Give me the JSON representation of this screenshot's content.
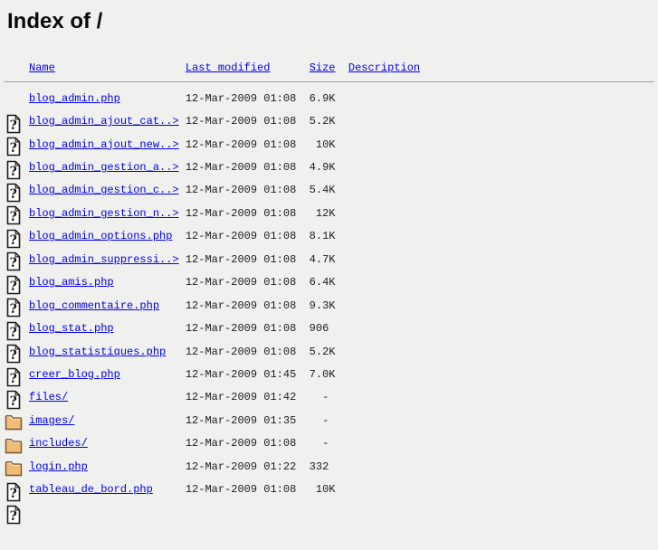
{
  "page_title": "Index of /",
  "listing": {
    "headers": [
      {
        "label": "Name"
      },
      {
        "label": "Last modified"
      },
      {
        "label": "Size"
      },
      {
        "label": "Description"
      }
    ],
    "rows": [
      {
        "icon": "unknown",
        "name": "blog_admin.php",
        "date": "12-Mar-2009 01:08",
        "size": "6.9K"
      },
      {
        "icon": "unknown",
        "name": "blog_admin_ajout_cat..>",
        "date": "12-Mar-2009 01:08",
        "size": "5.2K"
      },
      {
        "icon": "unknown",
        "name": "blog_admin_ajout_new..>",
        "date": "12-Mar-2009 01:08",
        "size": " 10K"
      },
      {
        "icon": "unknown",
        "name": "blog_admin_gestion_a..>",
        "date": "12-Mar-2009 01:08",
        "size": "4.9K"
      },
      {
        "icon": "unknown",
        "name": "blog_admin_gestion_c..>",
        "date": "12-Mar-2009 01:08",
        "size": "5.4K"
      },
      {
        "icon": "unknown",
        "name": "blog_admin_gestion_n..>",
        "date": "12-Mar-2009 01:08",
        "size": " 12K"
      },
      {
        "icon": "unknown",
        "name": "blog_admin_options.php",
        "date": "12-Mar-2009 01:08",
        "size": "8.1K"
      },
      {
        "icon": "unknown",
        "name": "blog_admin_suppressi..>",
        "date": "12-Mar-2009 01:08",
        "size": "4.7K"
      },
      {
        "icon": "unknown",
        "name": "blog_amis.php",
        "date": "12-Mar-2009 01:08",
        "size": "6.4K"
      },
      {
        "icon": "unknown",
        "name": "blog_commentaire.php",
        "date": "12-Mar-2009 01:08",
        "size": "9.3K"
      },
      {
        "icon": "unknown",
        "name": "blog_stat.php",
        "date": "12-Mar-2009 01:08",
        "size": "906 "
      },
      {
        "icon": "unknown",
        "name": "blog_statistiques.php",
        "date": "12-Mar-2009 01:08",
        "size": "5.2K"
      },
      {
        "icon": "unknown",
        "name": "creer_blog.php",
        "date": "12-Mar-2009 01:45",
        "size": "7.0K"
      },
      {
        "icon": "folder",
        "name": "files/",
        "date": "12-Mar-2009 01:42",
        "size": "  - "
      },
      {
        "icon": "folder",
        "name": "images/",
        "date": "12-Mar-2009 01:35",
        "size": "  - "
      },
      {
        "icon": "folder",
        "name": "includes/",
        "date": "12-Mar-2009 01:08",
        "size": "  - "
      },
      {
        "icon": "unknown",
        "name": "login.php",
        "date": "12-Mar-2009 01:22",
        "size": "332 "
      },
      {
        "icon": "unknown",
        "name": "tableau_de_bord.php",
        "date": "12-Mar-2009 01:08",
        "size": " 10K"
      }
    ]
  },
  "colors": {
    "background": "#f0f0ee",
    "link": "#0000ee",
    "text": "#1c1c1c",
    "heading": "#0a0a0a",
    "rule": "#9a9a9a",
    "folder_fill": "#f0bd77",
    "folder_outline": "#6e5335",
    "page_fill": "#ffffff",
    "page_outline": "#1a1a1a"
  }
}
